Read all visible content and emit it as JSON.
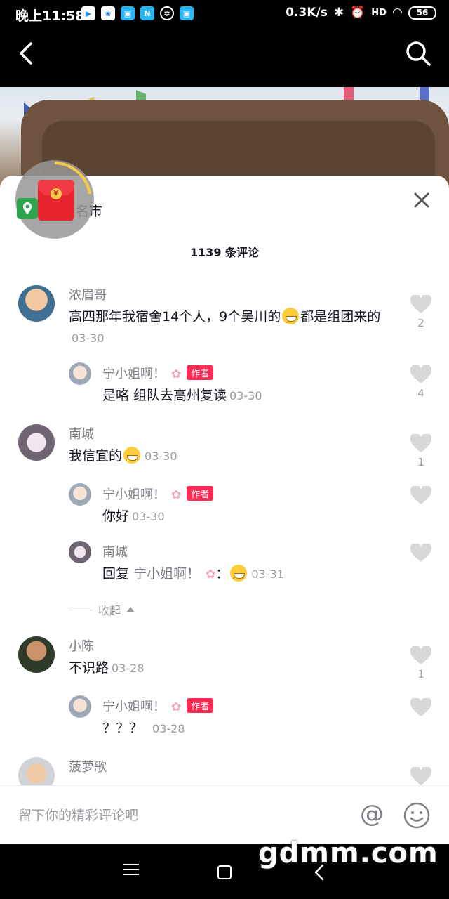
{
  "status_bar": {
    "time": "晚上11:58",
    "network_speed": "0.3K/s",
    "signal": "HD",
    "battery": "56"
  },
  "header": {
    "back_icon": "back-arrow-icon",
    "search_icon": "search-icon"
  },
  "location": {
    "label": "名市"
  },
  "panel": {
    "comment_count": "1139 条评论",
    "close_icon": "close-icon"
  },
  "comments": [
    {
      "username": "浓眉哥",
      "text": "高四那年我宿舍14个人，9个吴川的",
      "text_after_emoji": "都是组团来的",
      "date": "03-30",
      "likes": "2",
      "replies": [
        {
          "username": "宁小姐啊！",
          "badge": "作者",
          "text": "是咯 组队去高州复读",
          "date": "03-30",
          "likes": "4"
        }
      ]
    },
    {
      "username": "南城",
      "text": "我信宜的",
      "date": "03-30",
      "likes": "1",
      "replies": [
        {
          "username": "宁小姐啊！",
          "badge": "作者",
          "text": "你好",
          "date": "03-30",
          "likes": ""
        },
        {
          "username": "南城",
          "reply_prefix": "回复",
          "reply_target": "宁小姐啊！",
          "text": "：",
          "date": "03-31",
          "likes": ""
        }
      ],
      "collapse_label": "收起"
    },
    {
      "username": "小陈",
      "text": "不识路",
      "date": "03-28",
      "likes": "1",
      "replies": [
        {
          "username": "宁小姐啊！",
          "badge": "作者",
          "text": "？？？",
          "date": "03-28",
          "likes": ""
        }
      ]
    },
    {
      "username": "菠萝歌",
      "text": "",
      "date": "",
      "likes": ""
    }
  ],
  "input": {
    "placeholder": "留下你的精彩评论吧",
    "at_label": "@"
  },
  "watermark": "gdmm.com",
  "colors": {
    "accent": "#fe2c55",
    "text_primary": "#161823",
    "text_secondary": "#7d7f86"
  }
}
